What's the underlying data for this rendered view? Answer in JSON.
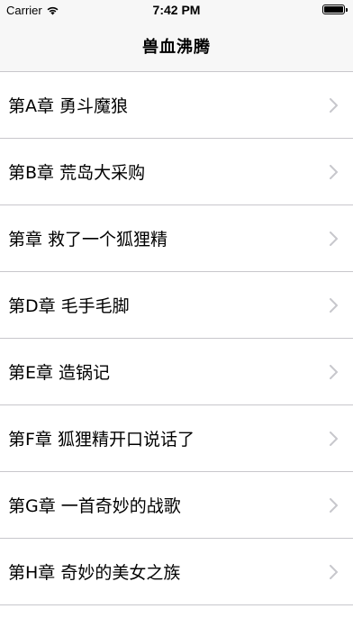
{
  "status_bar": {
    "carrier": "Carrier",
    "time": "7:42 PM",
    "wifi_icon": "wifi-icon",
    "battery_icon": "battery-icon",
    "battery_level": 1.0
  },
  "nav": {
    "title": "兽血沸腾"
  },
  "chapters": [
    {
      "label": "第A章 勇斗魔狼"
    },
    {
      "label": "第B章 荒岛大采购"
    },
    {
      "label": "第章 救了一个狐狸精"
    },
    {
      "label": "第D章 毛手毛脚"
    },
    {
      "label": "第E章 造锅记"
    },
    {
      "label": "第F章 狐狸精开口说话了"
    },
    {
      "label": "第G章 一首奇妙的战歌"
    },
    {
      "label": "第H章 奇妙的美女之族"
    }
  ],
  "icons": {
    "row_disclosure": "chevron-right-icon"
  },
  "colors": {
    "separator": "#c8c7cc",
    "chevron": "#c7c7cc",
    "nav_background": "#f7f7f7"
  }
}
